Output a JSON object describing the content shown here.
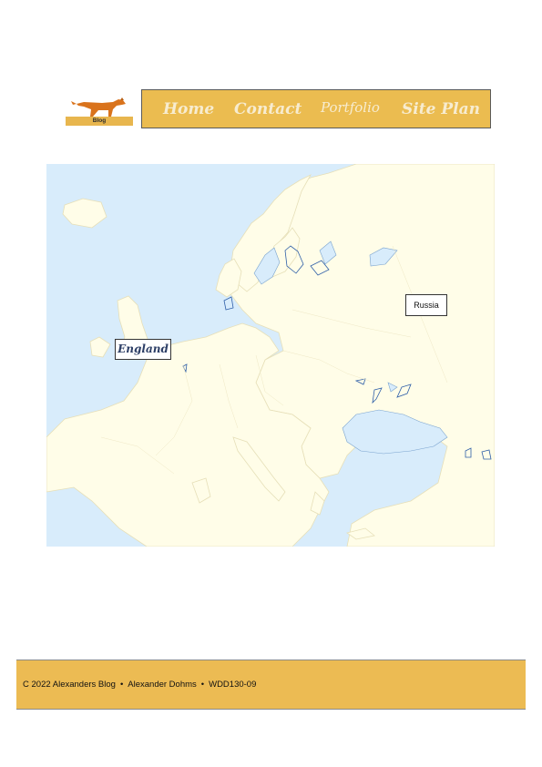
{
  "logo": {
    "text": "Blog",
    "icon": "dog-icon"
  },
  "nav": {
    "home": "Home",
    "contact": "Contact",
    "portfolio": "Portfolio",
    "site_plan": "Site Plan"
  },
  "map": {
    "labels": {
      "england": "England",
      "russia": "Russia"
    },
    "colors": {
      "sea": "#d8ecfb",
      "land": "#fffde8",
      "border": "#e8e2c0"
    }
  },
  "footer": {
    "copyright": "C 2022 Alexanders Blog",
    "author": "Alexander Dohms",
    "course": "WDD130-09",
    "separator": "•"
  },
  "colors": {
    "accent": "#ebbc50"
  }
}
